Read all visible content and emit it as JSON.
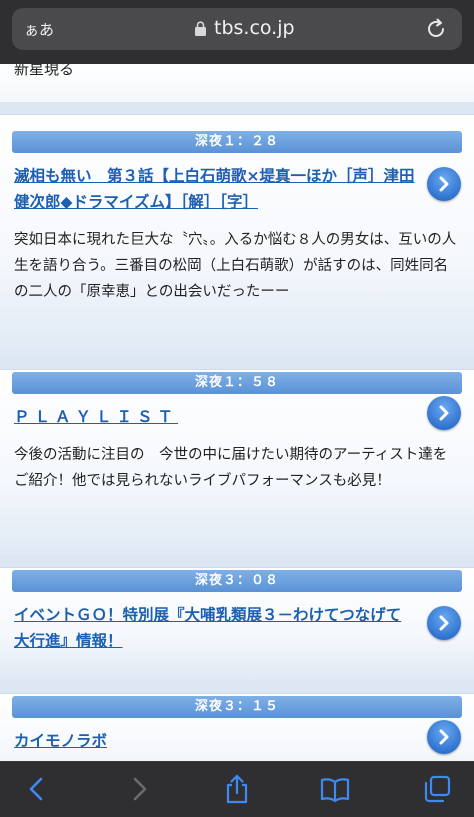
{
  "browser": {
    "text_size_label": "ぁあ",
    "url": "tbs.co.jp"
  },
  "partial_text": "新星現る",
  "programs": [
    {
      "time": "深夜１：２８",
      "title": "滅相も無い　第３話【上白石萌歌×堤真一ほか［声］津田健次郎◆ドラマイズム】［解］［字］",
      "description": "突如日本に現れた巨大な〝穴〟。入るか悩む８人の男女は、互いの人生を語り合う。三番目の松岡（上白石萌歌）が話すのは、同姓同名の二人の「原幸恵」との出会いだったーー"
    },
    {
      "time": "深夜１：５８",
      "title": "ＰＬＡＹＬＩＳＴ",
      "description": "今後の活動に注目の　今世の中に届けたい期待のアーティスト達をご紹介！他では見られないライブパフォーマンスも必見！"
    },
    {
      "time": "深夜３：０８",
      "title": "イベントＧＯ！特別展『大哺乳類展３－わけてつなげて大行進』情報！",
      "description": ""
    },
    {
      "time": "深夜３：１５",
      "title": "カイモノラボ",
      "description": ""
    }
  ],
  "icons": {
    "lock": "lock-icon",
    "reload": "reload-icon",
    "arrow": "chevron-right-circle-icon",
    "back": "back-icon",
    "forward": "forward-icon",
    "share": "share-icon",
    "bookmarks": "bookmarks-icon",
    "tabs": "tabs-icon"
  }
}
